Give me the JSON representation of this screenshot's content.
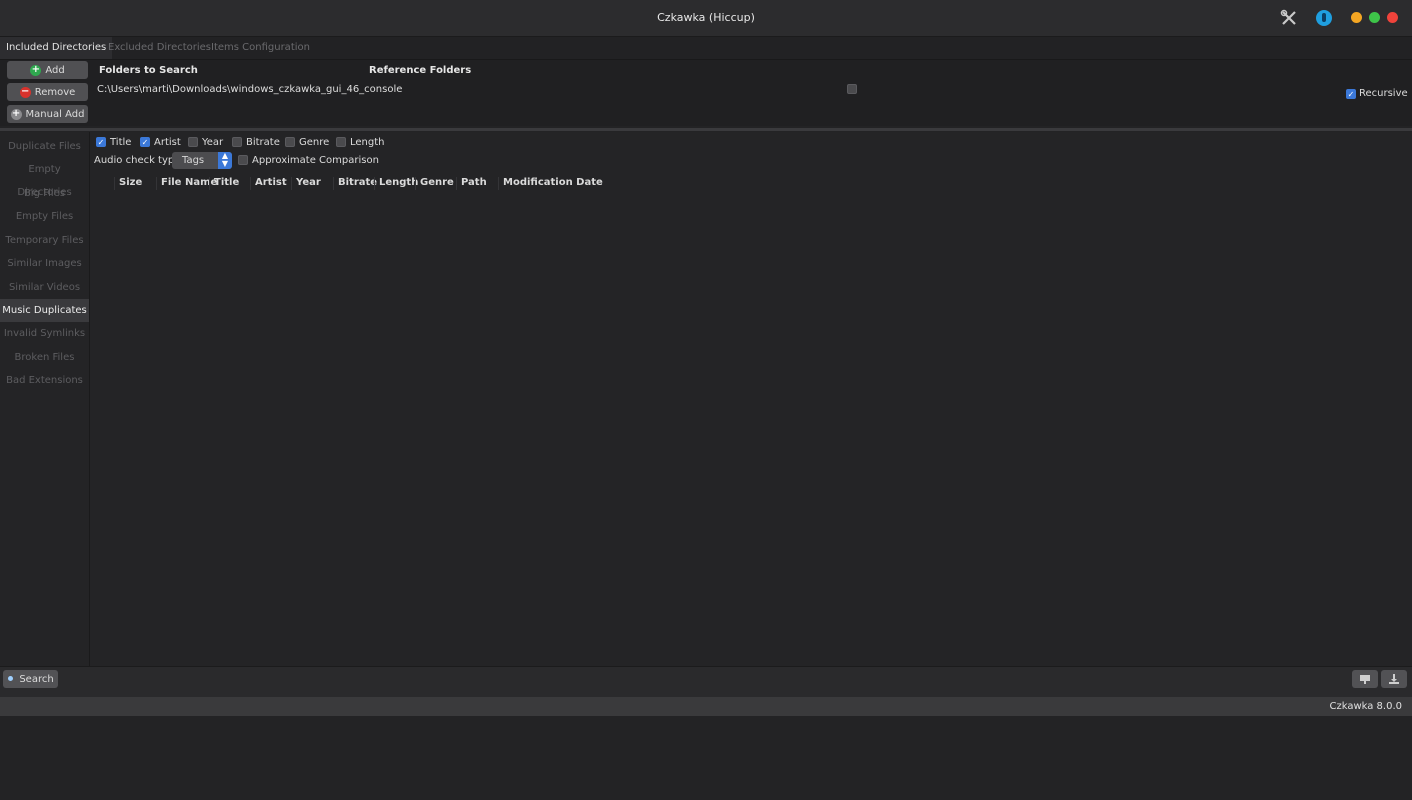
{
  "window": {
    "title": "Czkawka (Hiccup)",
    "controls": {
      "minimize_color": "#f5a623",
      "maximize_color": "#3ec449",
      "close_color": "#f0433b"
    },
    "tools_icon": "tools-icon",
    "donate_icon": "donate-icon"
  },
  "tabs": [
    {
      "label": "Included Directories",
      "active": true
    },
    {
      "label": "Excluded Directories",
      "active": false
    },
    {
      "label": "Items Configuration",
      "active": false
    }
  ],
  "dir_panel": {
    "buttons": {
      "add": "Add",
      "remove": "Remove",
      "manual_add": "Manual Add"
    },
    "folders_header": "Folders to Search",
    "reference_header": "Reference Folders",
    "folder_path": "C:\\Users\\marti\\Downloads\\windows_czkawka_gui_46_console",
    "reference_checked": false,
    "recursive_label": "Recursive",
    "recursive_checked": true
  },
  "nav": [
    {
      "label": "Duplicate Files",
      "active": false
    },
    {
      "label": "Empty Directories",
      "active": false
    },
    {
      "label": "Big Files",
      "active": false
    },
    {
      "label": "Empty Files",
      "active": false
    },
    {
      "label": "Temporary Files",
      "active": false
    },
    {
      "label": "Similar Images",
      "active": false
    },
    {
      "label": "Similar Videos",
      "active": false
    },
    {
      "label": "Music Duplicates",
      "active": true
    },
    {
      "label": "Invalid Symlinks",
      "active": false
    },
    {
      "label": "Broken Files",
      "active": false
    },
    {
      "label": "Bad Extensions",
      "active": false
    }
  ],
  "music": {
    "options": [
      {
        "label": "Title",
        "checked": true
      },
      {
        "label": "Artist",
        "checked": true
      },
      {
        "label": "Year",
        "checked": false
      },
      {
        "label": "Bitrate",
        "checked": false
      },
      {
        "label": "Genre",
        "checked": false
      },
      {
        "label": "Length",
        "checked": false
      }
    ],
    "audio_check_label": "Audio check type",
    "audio_check_value": "Tags",
    "approx_label": "Approximate Comparison",
    "approx_checked": false,
    "columns": [
      "Size",
      "File Name",
      "Title",
      "Artist",
      "Year",
      "Bitrate",
      "Length",
      "Genre",
      "Path",
      "Modification Date"
    ]
  },
  "bottom": {
    "search_label": "Search",
    "version": "Czkawka 8.0.0"
  },
  "colors": {
    "accent": "#3b78d8",
    "add_green": "#2fa84f",
    "remove_red": "#d8322c"
  }
}
